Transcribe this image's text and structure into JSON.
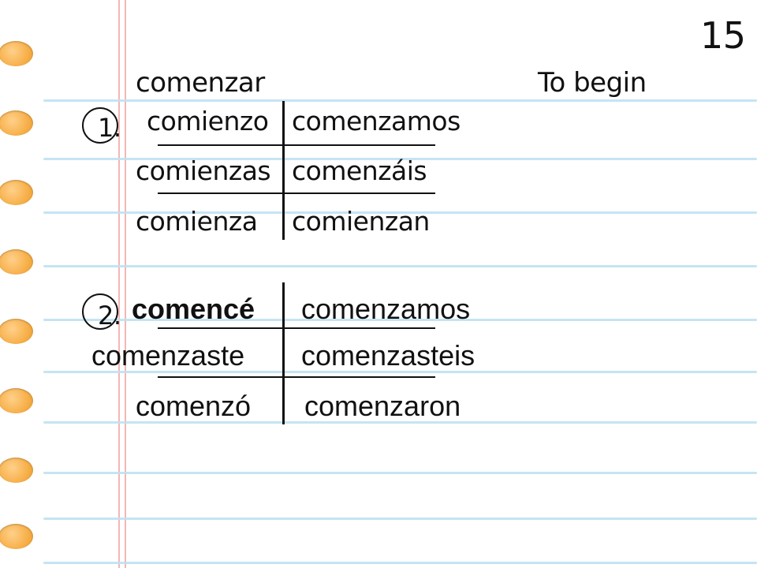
{
  "slide_number": "15",
  "header": {
    "infinitive": "comenzar",
    "translation": "To begin"
  },
  "section1": {
    "marker": "1.",
    "rows": [
      {
        "singular": "comienzo",
        "plural": "comenzamos"
      },
      {
        "singular": "comienzas",
        "plural": "comenzáis"
      },
      {
        "singular": "comienza",
        "plural": "comienzan"
      }
    ]
  },
  "section2": {
    "marker": "2.",
    "rows": [
      {
        "singular": "comencé",
        "plural": "comenzamos"
      },
      {
        "singular": "comenzaste",
        "plural": "comenzasteis"
      },
      {
        "singular": "comenzó",
        "plural": "comenzaron"
      }
    ]
  }
}
